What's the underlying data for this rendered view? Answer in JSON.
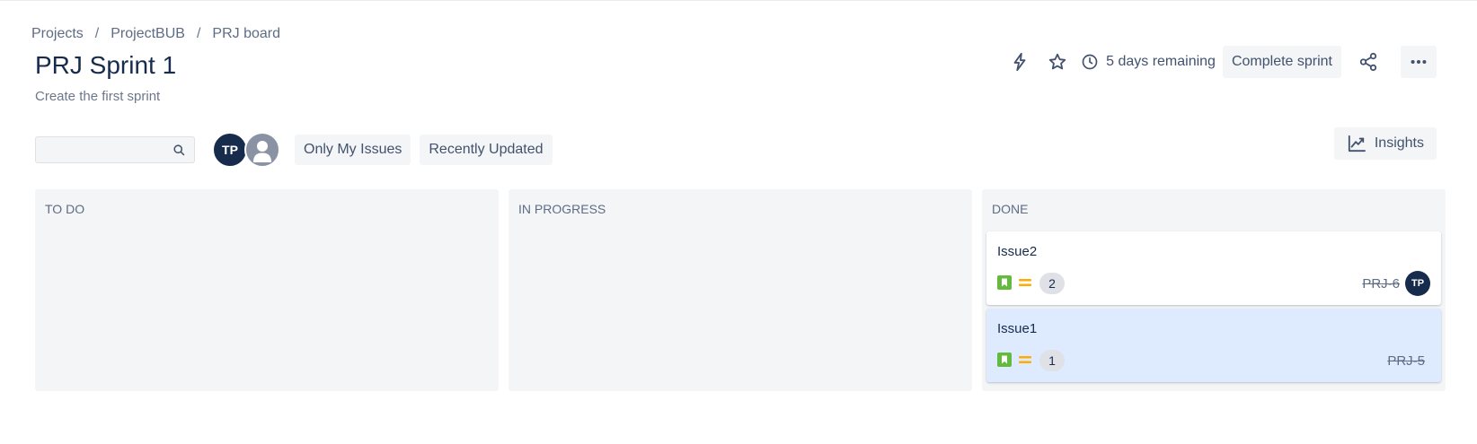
{
  "breadcrumb": [
    "Projects",
    "ProjectBUB",
    "PRJ board"
  ],
  "sprint": {
    "title": "PRJ Sprint 1",
    "goal": "Create the first sprint"
  },
  "header": {
    "remaining": "5 days remaining",
    "complete_label": "Complete sprint"
  },
  "toolbar": {
    "search_value": "",
    "assignee_initials": "TP",
    "filters": [
      "Only My Issues",
      "Recently Updated"
    ],
    "insights_label": "Insights"
  },
  "columns": [
    {
      "name": "TO DO",
      "cards": []
    },
    {
      "name": "IN PROGRESS",
      "cards": []
    },
    {
      "name": "DONE",
      "cards": [
        {
          "summary": "Issue2",
          "points": "2",
          "key": "PRJ-6",
          "assignee": "TP",
          "type_icon": "story-icon",
          "priority_icon": "priority-medium-icon"
        },
        {
          "summary": "Issue1",
          "points": "1",
          "key": "PRJ-5",
          "assignee": "",
          "type_icon": "story-icon",
          "priority_icon": "priority-medium-icon"
        }
      ]
    }
  ],
  "colors": {
    "text": "#172b4d",
    "column_bg": "#f4f5f7",
    "selected_card": "#deebff",
    "story": "#63ba3c",
    "priority_medium": "#ffab00",
    "avatar": "#172b4d"
  }
}
